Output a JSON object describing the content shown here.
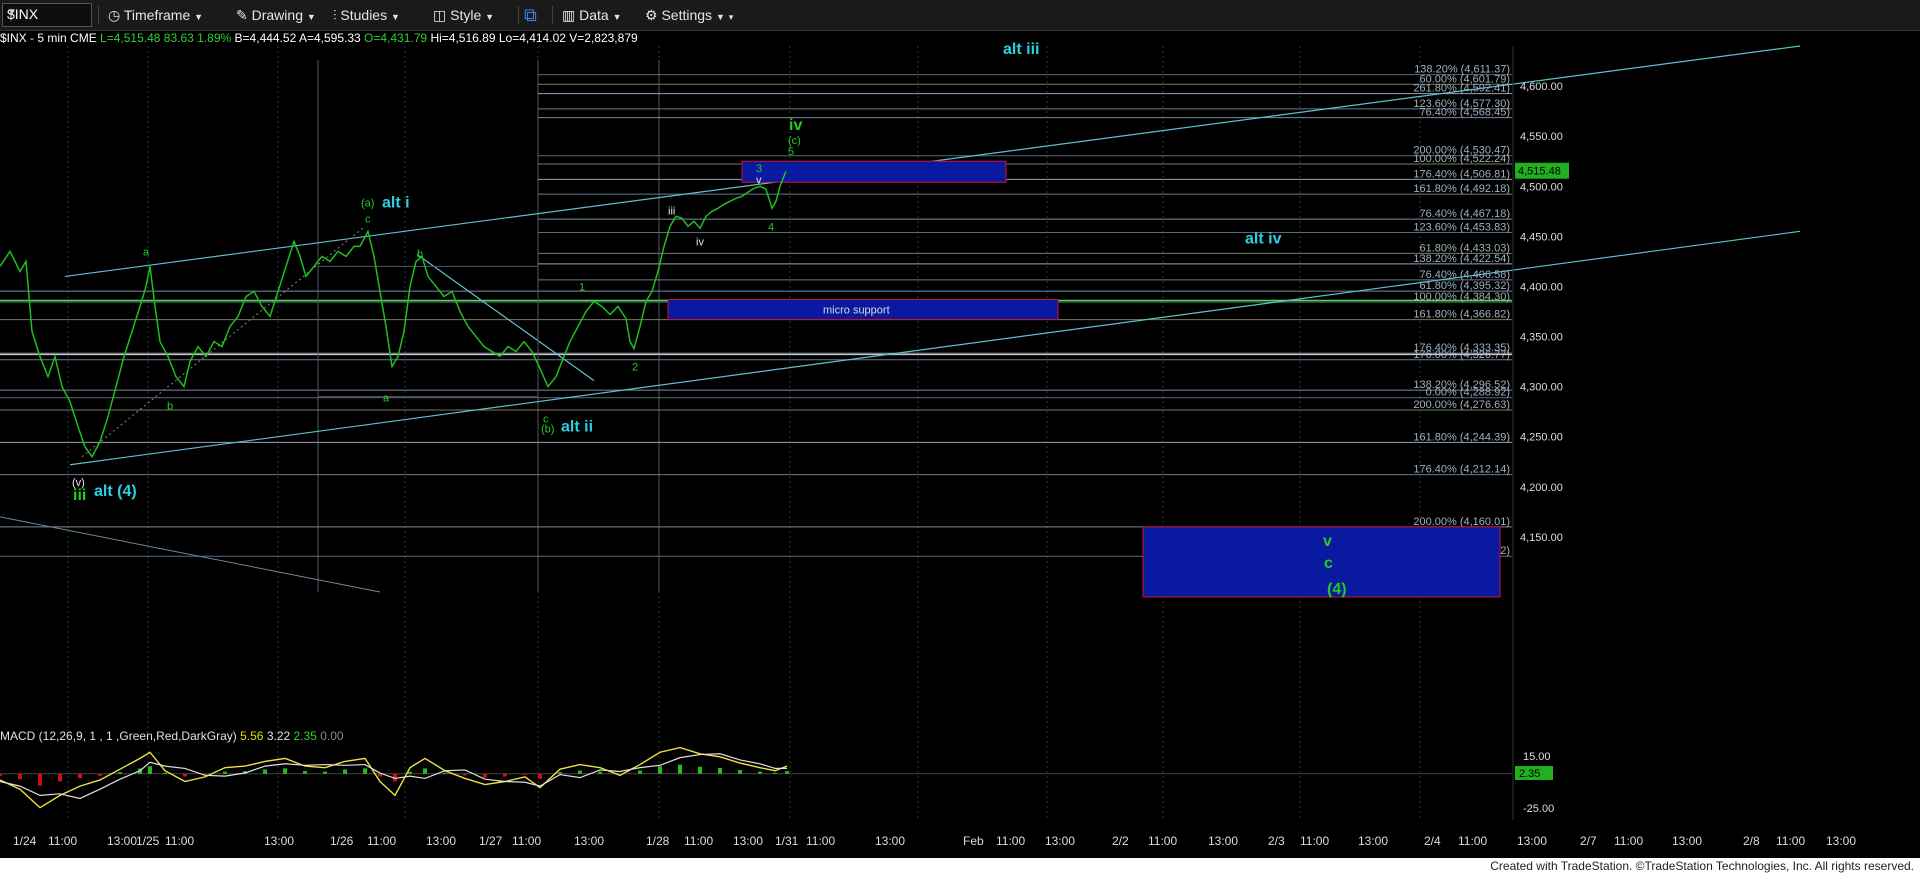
{
  "toolbar": {
    "symbol": "$INX",
    "timeframe": "Timeframe",
    "drawing": "Drawing",
    "studies": "Studies",
    "style": "Style",
    "data": "Data",
    "settings": "Settings"
  },
  "info": {
    "symbol": "$INX - 5 min",
    "exchange": "CME",
    "last": "L=4,515.48",
    "change": "83.63",
    "pct": "1.89%",
    "bid": "B=4,444.52",
    "ask": "A=4,595.33",
    "open": "O=4,431.79",
    "high": "Hi=4,516.89",
    "low": "Lo=4,414.02",
    "volume": "V=2,823,879"
  },
  "macd": {
    "label": "MACD (12,26,9, 1 , 1 ,Green,Red,DarkGray)",
    "v1": "5.56",
    "v2": "3.22",
    "v3": "2.35",
    "v4": "0.00",
    "ticks": [
      "15.00",
      "-25.00"
    ],
    "value_label": "2.35"
  },
  "footer": "Created with TradeStation. ©TradeStation Technologies, Inc. All rights reserved.",
  "colors": {
    "up": "#1fbf1f",
    "down": "#d01010",
    "teal_line": "#5fc0d0",
    "wave_label_teal": "#2ad0e0",
    "wave_label_green": "#22cc22",
    "fib_text": "#9fb0c0",
    "price_label_bg": "#20b020"
  },
  "chart_data": {
    "type": "line",
    "title": "",
    "series_name": "$INX - 5 min",
    "ylim": [
      4095,
      4640
    ],
    "yticks": [
      4150,
      4200,
      4250,
      4300,
      4350,
      4400,
      4450,
      4500,
      4550,
      4600
    ],
    "ytick_labels": [
      "4,150.00",
      "4,200.00",
      "4,250.00",
      "4,300.00",
      "4,350.00",
      "4,400.00",
      "4,450.00",
      "4,500.00",
      "4,550.00",
      "4,600.00"
    ],
    "last_price": 4515.48,
    "last_price_label": "4,515.48",
    "xtick_labels": [
      "1/24",
      "11:00",
      "13:00",
      "1/25",
      "11:00",
      "13:00",
      "1/26",
      "11:00",
      "13:00",
      "1/27",
      "11:00",
      "13:00",
      "1/28",
      "11:00",
      "13:00",
      "1/31",
      "11:00",
      "13:00",
      "Feb",
      "11:00",
      "13:00",
      "2/2",
      "11:00",
      "13:00",
      "2/3",
      "11:00",
      "13:00",
      "2/4",
      "11:00",
      "13:00",
      "2/7",
      "11:00",
      "13:00",
      "2/8",
      "11:00",
      "13:00"
    ],
    "price_path": [
      [
        0,
        4420
      ],
      [
        10,
        4435
      ],
      [
        20,
        4415
      ],
      [
        26,
        4425
      ],
      [
        32,
        4355
      ],
      [
        40,
        4330
      ],
      [
        48,
        4310
      ],
      [
        55,
        4330
      ],
      [
        62,
        4300
      ],
      [
        70,
        4285
      ],
      [
        78,
        4260
      ],
      [
        85,
        4240
      ],
      [
        92,
        4230
      ],
      [
        100,
        4245
      ],
      [
        108,
        4270
      ],
      [
        116,
        4300
      ],
      [
        124,
        4330
      ],
      [
        132,
        4355
      ],
      [
        140,
        4380
      ],
      [
        146,
        4400
      ],
      [
        150,
        4420
      ],
      [
        155,
        4380
      ],
      [
        160,
        4345
      ],
      [
        168,
        4330
      ],
      [
        176,
        4310
      ],
      [
        184,
        4300
      ],
      [
        190,
        4325
      ],
      [
        198,
        4340
      ],
      [
        206,
        4330
      ],
      [
        214,
        4345
      ],
      [
        222,
        4340
      ],
      [
        230,
        4360
      ],
      [
        238,
        4370
      ],
      [
        246,
        4390
      ],
      [
        254,
        4395
      ],
      [
        262,
        4380
      ],
      [
        270,
        4370
      ],
      [
        278,
        4395
      ],
      [
        286,
        4420
      ],
      [
        294,
        4445
      ],
      [
        300,
        4430
      ],
      [
        306,
        4410
      ],
      [
        314,
        4420
      ],
      [
        322,
        4430
      ],
      [
        330,
        4425
      ],
      [
        338,
        4435
      ],
      [
        346,
        4430
      ],
      [
        354,
        4440
      ],
      [
        360,
        4440
      ],
      [
        368,
        4455
      ],
      [
        374,
        4430
      ],
      [
        380,
        4395
      ],
      [
        386,
        4360
      ],
      [
        392,
        4320
      ],
      [
        398,
        4330
      ],
      [
        404,
        4355
      ],
      [
        410,
        4400
      ],
      [
        416,
        4425
      ],
      [
        422,
        4430
      ],
      [
        428,
        4410
      ],
      [
        436,
        4400
      ],
      [
        444,
        4390
      ],
      [
        452,
        4395
      ],
      [
        460,
        4375
      ],
      [
        468,
        4360
      ],
      [
        476,
        4350
      ],
      [
        484,
        4340
      ],
      [
        492,
        4335
      ],
      [
        500,
        4330
      ],
      [
        508,
        4340
      ],
      [
        516,
        4335
      ],
      [
        524,
        4345
      ],
      [
        532,
        4335
      ],
      [
        540,
        4318
      ],
      [
        548,
        4300
      ],
      [
        556,
        4310
      ],
      [
        562,
        4325
      ],
      [
        570,
        4345
      ],
      [
        578,
        4360
      ],
      [
        586,
        4375
      ],
      [
        594,
        4385
      ],
      [
        602,
        4380
      ],
      [
        610,
        4372
      ],
      [
        618,
        4380
      ],
      [
        626,
        4368
      ],
      [
        630,
        4345
      ],
      [
        634,
        4338
      ],
      [
        640,
        4360
      ],
      [
        646,
        4385
      ],
      [
        652,
        4395
      ],
      [
        658,
        4415
      ],
      [
        664,
        4440
      ],
      [
        670,
        4460
      ],
      [
        676,
        4470
      ],
      [
        682,
        4468
      ],
      [
        688,
        4460
      ],
      [
        694,
        4465
      ],
      [
        700,
        4458
      ],
      [
        706,
        4470
      ],
      [
        712,
        4475
      ],
      [
        718,
        4478
      ],
      [
        724,
        4482
      ],
      [
        730,
        4485
      ],
      [
        736,
        4488
      ],
      [
        742,
        4490
      ],
      [
        748,
        4494
      ],
      [
        754,
        4498
      ],
      [
        760,
        4500
      ],
      [
        766,
        4497
      ],
      [
        772,
        4478
      ],
      [
        776,
        4485
      ],
      [
        780,
        4500
      ],
      [
        784,
        4510
      ],
      [
        786,
        4515
      ]
    ],
    "macd_path": [
      [
        0,
        -4
      ],
      [
        20,
        -10
      ],
      [
        40,
        -22
      ],
      [
        60,
        -14
      ],
      [
        80,
        -8
      ],
      [
        100,
        -4
      ],
      [
        120,
        3
      ],
      [
        140,
        10
      ],
      [
        150,
        14
      ],
      [
        165,
        2
      ],
      [
        185,
        -5
      ],
      [
        205,
        -2
      ],
      [
        225,
        4
      ],
      [
        245,
        5
      ],
      [
        265,
        8
      ],
      [
        285,
        10
      ],
      [
        305,
        5
      ],
      [
        325,
        4
      ],
      [
        345,
        8
      ],
      [
        365,
        10
      ],
      [
        380,
        -5
      ],
      [
        395,
        -14
      ],
      [
        410,
        4
      ],
      [
        425,
        10
      ],
      [
        445,
        2
      ],
      [
        465,
        -3
      ],
      [
        485,
        -7
      ],
      [
        505,
        -5
      ],
      [
        525,
        -2
      ],
      [
        540,
        -9
      ],
      [
        560,
        3
      ],
      [
        580,
        6
      ],
      [
        600,
        4
      ],
      [
        620,
        -1
      ],
      [
        640,
        6
      ],
      [
        660,
        14
      ],
      [
        680,
        17
      ],
      [
        700,
        13
      ],
      [
        720,
        11
      ],
      [
        740,
        7
      ],
      [
        760,
        4
      ],
      [
        775,
        2
      ],
      [
        787,
        5
      ]
    ],
    "fib_levels": [
      {
        "label": "138.20% (4,611.37)",
        "value": 4611.37
      },
      {
        "label": "60.00% (4,601.79)",
        "value": 4601.79
      },
      {
        "label": "261.80% (4,592.41)",
        "value": 4592.41
      },
      {
        "label": "123.60% (4,577.30)",
        "value": 4577.3
      },
      {
        "label": "76.40% (4,568.45)",
        "value": 4568.45
      },
      {
        "label": "200.00% (4,530.47)",
        "value": 4530.47
      },
      {
        "label": "100.00% (4,522.24)",
        "value": 4522.24
      },
      {
        "label": "176.40% (4,506.81)",
        "value": 4506.81
      },
      {
        "label": "161.80% (4,492.18)",
        "value": 4492.18
      },
      {
        "label": "76.40% (4,467.18)",
        "value": 4467.18
      },
      {
        "label": "123.60% (4,453.83)",
        "value": 4453.83
      },
      {
        "label": "61.80% (4,433.03)",
        "value": 4433.03
      },
      {
        "label": "138.20% (4,422.54)",
        "value": 4422.54
      },
      {
        "label": "76.40% (4,406.58)",
        "value": 4406.58
      },
      {
        "label": "61.80% (4,395.32)",
        "value": 4395.32
      },
      {
        "label": "100.00% (4,384.30)",
        "value": 4384.3
      },
      {
        "label": "161.80% (4,366.82)",
        "value": 4366.82
      },
      {
        "label": "176.40% (4,333.35)",
        "value": 4333.35
      },
      {
        "label": "176.00% (4,326.77)",
        "value": 4326.77
      },
      {
        "label": "138.20% (4,296.52)",
        "value": 4296.52
      },
      {
        "label": "0.00% (4,288.92)",
        "value": 4288.92
      },
      {
        "label": "200.00% (4,276.63)",
        "value": 4276.63
      },
      {
        "label": "161.80% (4,244.39)",
        "value": 4244.39
      },
      {
        "label": "176.40% (4,212.14)",
        "value": 4212.14
      },
      {
        "label": "200.00% (4,160.01)",
        "value": 4160.01
      },
      {
        "label": "261.80% (4,130.72)",
        "value": 4130.72
      }
    ],
    "boxes": [
      {
        "name": "upper-target-box",
        "label": "",
        "x0": 742,
        "x1": 1006,
        "y0": 4525,
        "y1": 4504
      },
      {
        "name": "micro-support-box",
        "label": "micro support",
        "x0": 668,
        "x1": 1058,
        "y0": 4387,
        "y1": 4367
      },
      {
        "name": "wave-4-target-box",
        "label": "",
        "x0": 1143,
        "x1": 1500,
        "y0": 4160,
        "y1": 4090
      }
    ],
    "wave_labels": [
      {
        "t": "alt iii",
        "x": 1003,
        "y": 4632,
        "c": "teal",
        "s": "big"
      },
      {
        "t": "iv",
        "x": 789,
        "y": 4556,
        "c": "green",
        "s": "big"
      },
      {
        "t": "(c)",
        "x": 788,
        "y": 4542,
        "c": "green",
        "s": "small"
      },
      {
        "t": "5",
        "x": 788,
        "y": 4531,
        "c": "green",
        "s": "small"
      },
      {
        "t": "3",
        "x": 756,
        "y": 4514,
        "c": "green",
        "s": "small"
      },
      {
        "t": "v",
        "x": 756,
        "y": 4503,
        "c": "white",
        "s": "small"
      },
      {
        "t": "iii",
        "x": 668,
        "y": 4472,
        "c": "white",
        "s": "small"
      },
      {
        "t": "4",
        "x": 768,
        "y": 4456,
        "c": "green",
        "s": "small"
      },
      {
        "t": "iv",
        "x": 696,
        "y": 4441,
        "c": "white",
        "s": "small"
      },
      {
        "t": "alt iv",
        "x": 1245,
        "y": 4443,
        "c": "teal",
        "s": "big"
      },
      {
        "t": "(a)",
        "x": 361,
        "y": 4480,
        "c": "green",
        "s": "small"
      },
      {
        "t": "alt i",
        "x": 382,
        "y": 4479,
        "c": "teal",
        "s": "big"
      },
      {
        "t": "c",
        "x": 365,
        "y": 4464,
        "c": "green",
        "s": "small"
      },
      {
        "t": "a",
        "x": 143,
        "y": 4431,
        "c": "green",
        "s": "small"
      },
      {
        "t": "b",
        "x": 417,
        "y": 4429,
        "c": "green",
        "s": "small"
      },
      {
        "t": "1",
        "x": 579,
        "y": 4396,
        "c": "green",
        "s": "small"
      },
      {
        "t": "2",
        "x": 632,
        "y": 4316,
        "c": "green",
        "s": "small"
      },
      {
        "t": "a",
        "x": 383,
        "y": 4285,
        "c": "green",
        "s": "small"
      },
      {
        "t": "b",
        "x": 167,
        "y": 4277,
        "c": "green",
        "s": "small"
      },
      {
        "t": "c",
        "x": 543,
        "y": 4264,
        "c": "green",
        "s": "small"
      },
      {
        "t": "(b)",
        "x": 541,
        "y": 4254,
        "c": "green",
        "s": "small"
      },
      {
        "t": "alt ii",
        "x": 561,
        "y": 4255,
        "c": "teal",
        "s": "big"
      },
      {
        "t": "(v)",
        "x": 72,
        "y": 4201,
        "c": "white",
        "s": "small"
      },
      {
        "t": "iii",
        "x": 73,
        "y": 4187,
        "c": "green",
        "s": "big"
      },
      {
        "t": "alt (4)",
        "x": 94,
        "y": 4191,
        "c": "teal",
        "s": "big"
      },
      {
        "t": "v",
        "x": 1323,
        "y": 4141,
        "c": "green",
        "s": "big"
      },
      {
        "t": "c",
        "x": 1324,
        "y": 4119,
        "c": "green",
        "s": "big"
      },
      {
        "t": "(4)",
        "x": 1327,
        "y": 4093,
        "c": "green",
        "s": "big"
      }
    ]
  }
}
